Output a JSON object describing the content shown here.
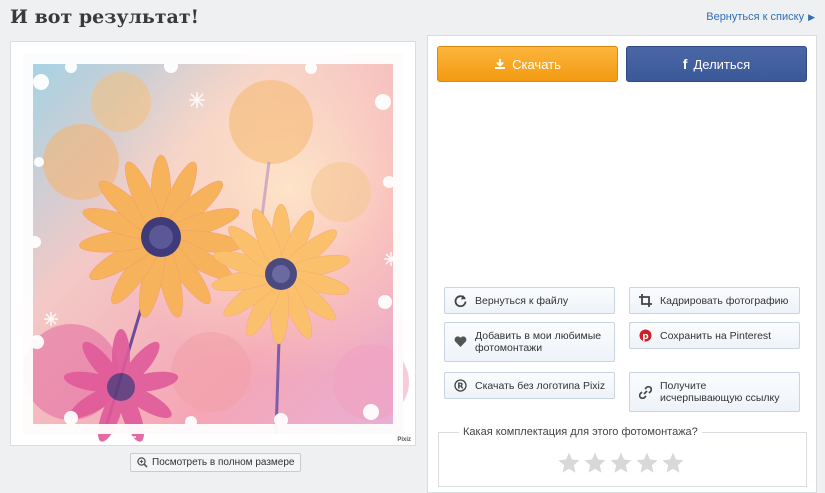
{
  "page": {
    "title": "И вот результат!",
    "back_to_list": "Вернуться к списку"
  },
  "photo": {
    "watermark": "Pixiz",
    "fullsize_label": "Посмотреть в полном размере"
  },
  "actions": {
    "download_label": "Скачать",
    "share_label": "Делиться",
    "back_to_file": "Вернуться к файлу",
    "crop_photo": "Кадрировать фотографию",
    "add_favorites": "Добавить в мои любимые фотомонтажи",
    "save_pinterest": "Сохранить на Pinterest",
    "download_no_logo": "Скачать без логотипа Pixiz",
    "get_link": "Получите исчерпывающую ссылку"
  },
  "rating": {
    "question": "Какая комплектация для этого фотомонтажа?",
    "stars_total": 5,
    "stars_filled": 0
  },
  "colors": {
    "download": "#f6a623",
    "share": "#3b5998",
    "link": "#2f6fb3",
    "pinterest": "#cb2027"
  }
}
